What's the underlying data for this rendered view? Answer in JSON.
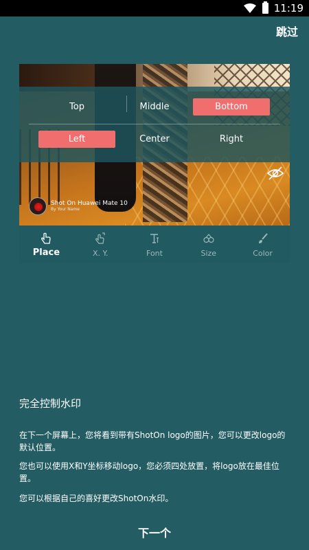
{
  "status_bar": {
    "time": "11:19",
    "wifi_icon": "wifi-icon",
    "battery_icon": "battery-icon"
  },
  "header": {
    "skip_label": "跳过"
  },
  "preview": {
    "position_buttons": {
      "row1": [
        {
          "label": "Top",
          "active": false
        },
        {
          "label": "Middle",
          "active": false
        },
        {
          "label": "Bottom",
          "active": true
        }
      ],
      "row2": [
        {
          "label": "Left",
          "active": true
        },
        {
          "label": "Center",
          "active": false
        },
        {
          "label": "Right",
          "active": false
        }
      ]
    },
    "visibility_icon": "eye-off-icon",
    "watermark": {
      "title": "Shot On Huawei Mate 10",
      "subtitle": "By Your Name"
    },
    "toolbar": [
      {
        "label": "Place",
        "icon": "hand-pointer-icon",
        "active": true
      },
      {
        "label": "X. Y.",
        "icon": "drag-hand-icon",
        "active": false
      },
      {
        "label": "Font",
        "icon": "font-icon",
        "active": false
      },
      {
        "label": "Size",
        "icon": "scale-icon",
        "active": false
      },
      {
        "label": "Color",
        "icon": "brush-icon",
        "active": false
      }
    ]
  },
  "content": {
    "heading": "完全控制水印",
    "paragraphs": [
      "在下一个屏幕上，您将看到带有ShotOn logo的图片，您可以更改logo的默认位置。",
      "您也可以使用X和Y坐标移动logo，您必须四处放置，将logo放在最佳位置。",
      "您可以根据自己的喜好更改ShotOn水印。"
    ]
  },
  "footer": {
    "next_label": "下一个"
  },
  "colors": {
    "background": "#235c63",
    "overlay": "#1f575e",
    "accent": "#f06e6e",
    "toolbar": "#215a61"
  }
}
